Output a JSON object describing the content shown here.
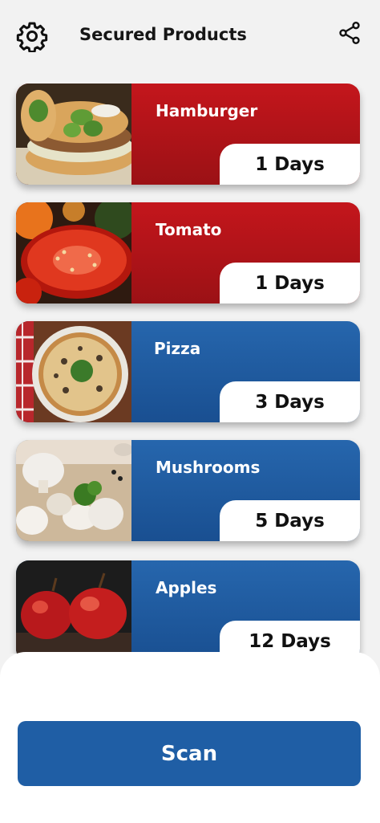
{
  "header": {
    "title": "Secured Products",
    "settings_icon": "gear-icon",
    "share_icon": "share-icon"
  },
  "products": [
    {
      "name": "Hamburger",
      "days": "1 Days",
      "status_color": "#b8151b",
      "image": "hamburger-image"
    },
    {
      "name": "Tomato",
      "days": "1 Days",
      "status_color": "#b8151b",
      "image": "tomato-image"
    },
    {
      "name": "Pizza",
      "days": "3 Days",
      "status_color": "#1f5ea5",
      "image": "pizza-image"
    },
    {
      "name": "Mushrooms",
      "days": "5 Days",
      "status_color": "#1f5ea5",
      "image": "mushrooms-image"
    },
    {
      "name": "Apples",
      "days": "12 Days",
      "status_color": "#1f5ea5",
      "image": "apples-image"
    }
  ],
  "footer": {
    "scan_label": "Scan"
  }
}
